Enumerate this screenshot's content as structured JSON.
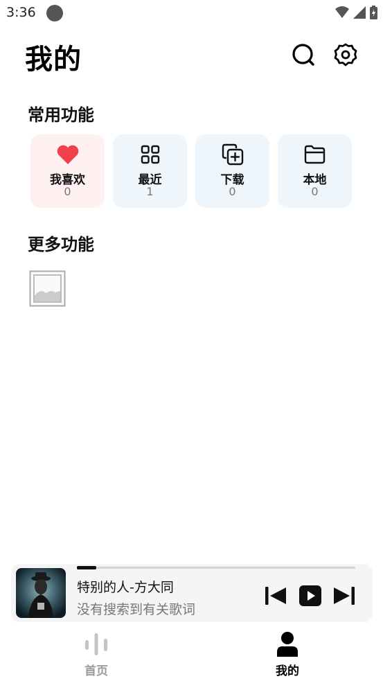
{
  "status_bar": {
    "time": "3:36"
  },
  "header": {
    "title": "我的"
  },
  "common_section": {
    "title": "常用功能",
    "tiles": [
      {
        "label": "我喜欢",
        "count": "0",
        "icon": "heart-icon",
        "color": "#f0404a"
      },
      {
        "label": "最近",
        "count": "1",
        "icon": "grid-icon"
      },
      {
        "label": "下载",
        "count": "0",
        "icon": "add-copy-icon"
      },
      {
        "label": "本地",
        "count": "0",
        "icon": "folder-icon"
      }
    ]
  },
  "more_section": {
    "title": "更多功能",
    "item_icon": "image-placeholder-icon"
  },
  "player": {
    "song": "特别的人-方大同",
    "lyric": "没有搜索到有关歌词",
    "progress": 0.07
  },
  "nav": [
    {
      "label": "首页",
      "icon": "audio-bars-icon",
      "active": false
    },
    {
      "label": "我的",
      "icon": "person-icon",
      "active": true
    }
  ]
}
